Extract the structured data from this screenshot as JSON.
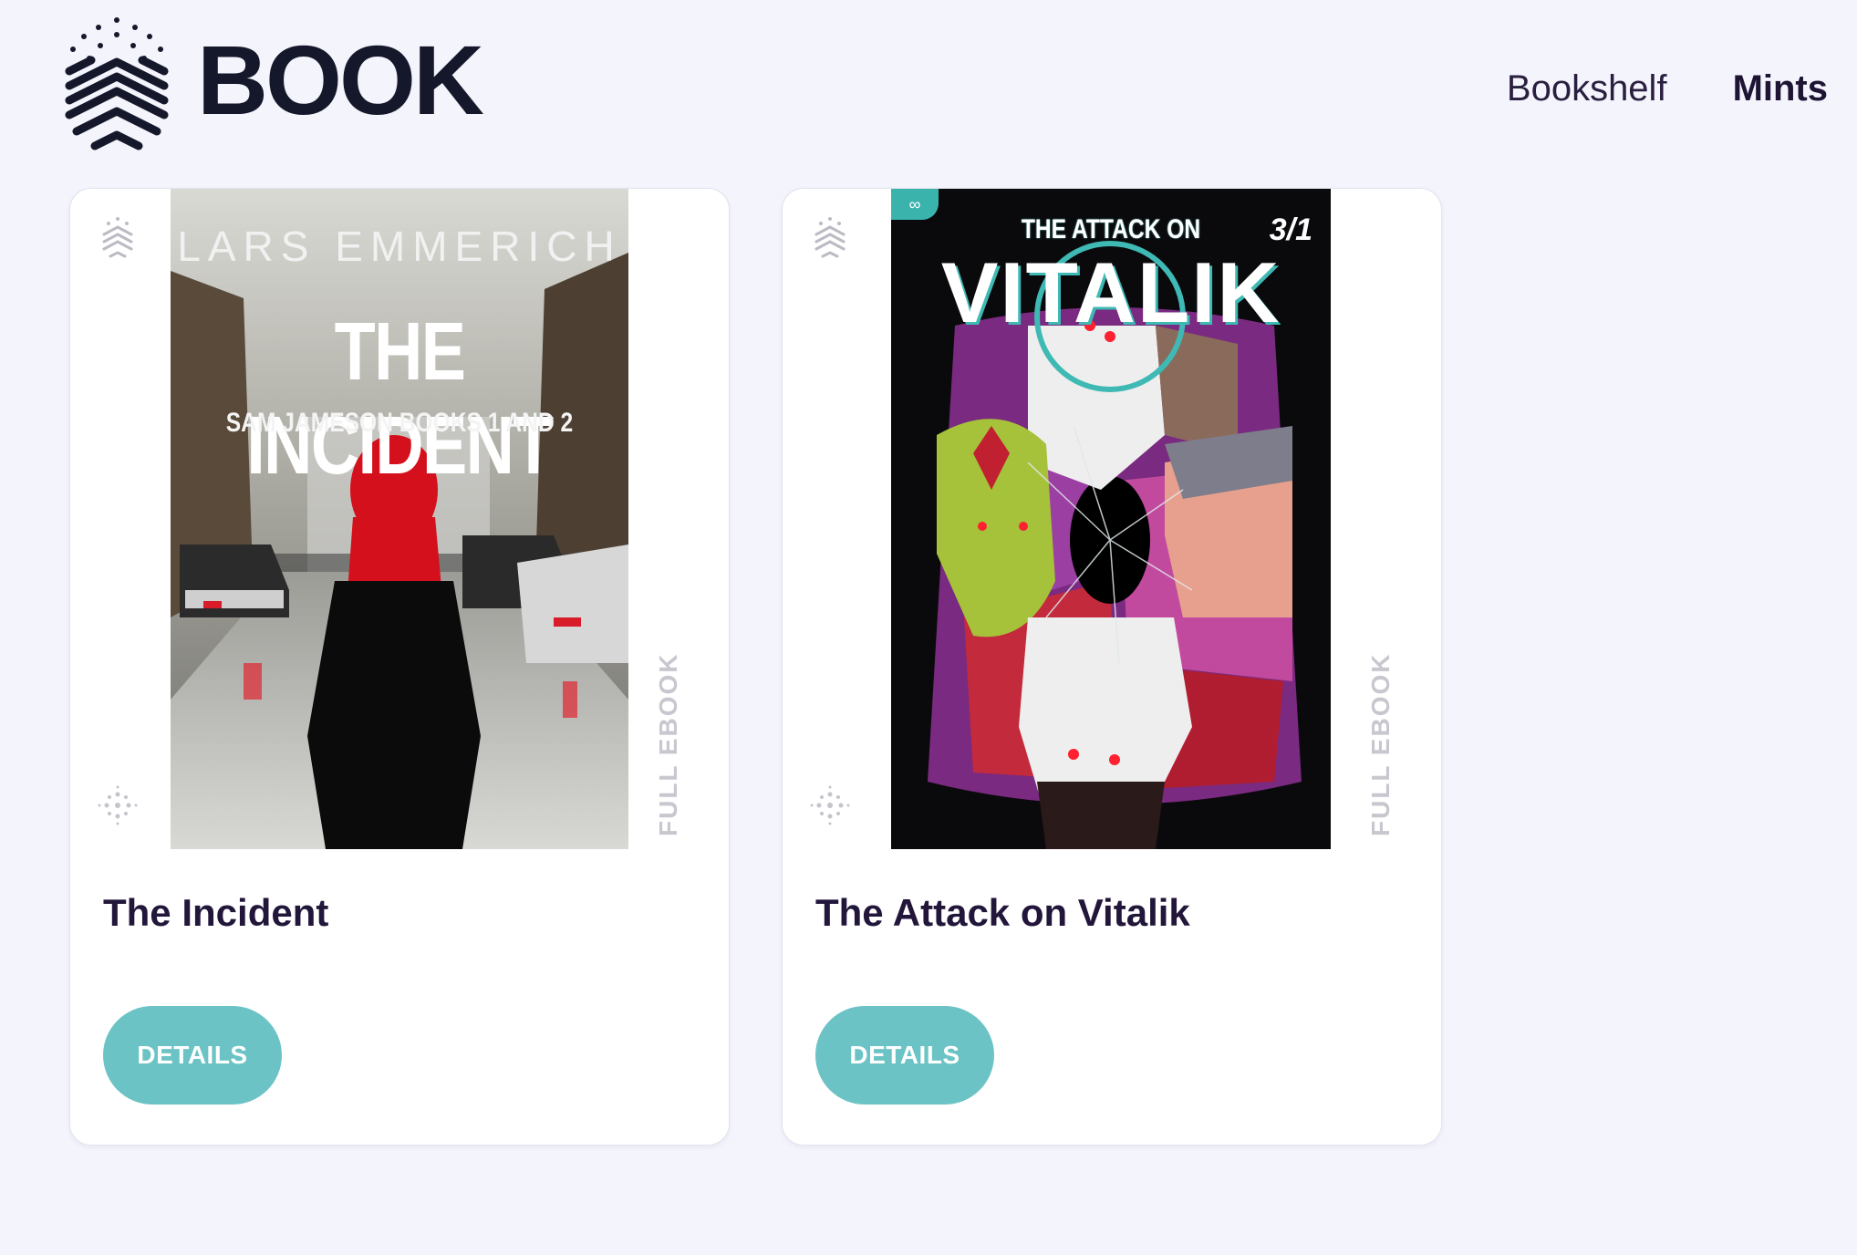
{
  "brand": {
    "name": "BOOK"
  },
  "nav": [
    {
      "label": "Bookshelf",
      "active": false
    },
    {
      "label": "Mints",
      "active": true
    }
  ],
  "books": [
    {
      "title": "The Incident",
      "format_label": "FULL EBOOK",
      "details_label": "DETAILS",
      "cover": {
        "author": "LARS EMMERICH",
        "title": "THE INCIDENT",
        "subtitle": "SAM JAMESON BOOKS 1 AND 2"
      }
    },
    {
      "title": "The Attack on Vitalik",
      "format_label": "FULL EBOOK",
      "details_label": "DETAILS",
      "cover": {
        "top_line": "THE ATTACK ON",
        "title": "VITALIK",
        "issue": "3/1"
      }
    }
  ],
  "colors": {
    "background": "#f4f4fd",
    "accent": "#6cc3c5",
    "text": "#22163a"
  }
}
